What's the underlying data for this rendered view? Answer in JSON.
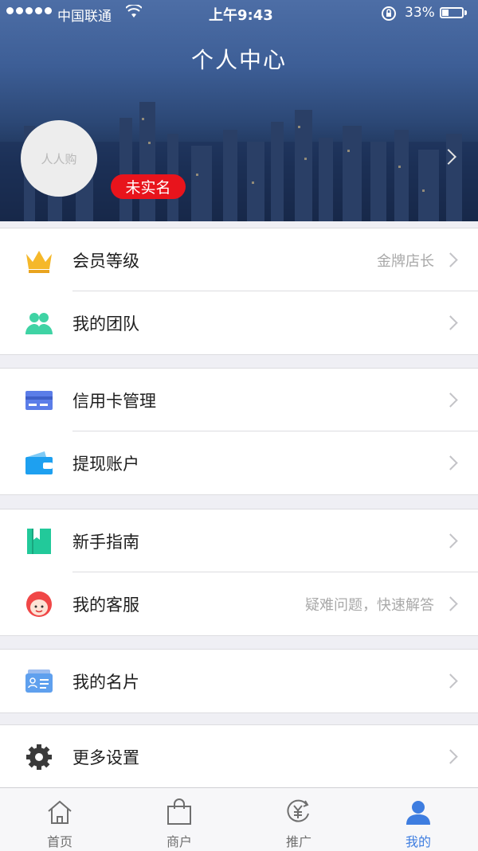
{
  "status_bar": {
    "carrier": "中国联通",
    "time": "上午9:43",
    "battery": "33%"
  },
  "header": {
    "title": "个人中心",
    "avatar_text": "人人购",
    "badge": "未实名"
  },
  "sections": [
    {
      "rows": [
        {
          "label": "会员等级",
          "value": "金牌店长",
          "icon": "crown-icon"
        },
        {
          "label": "我的团队",
          "value": "",
          "icon": "team-icon"
        }
      ]
    },
    {
      "rows": [
        {
          "label": "信用卡管理",
          "value": "",
          "icon": "credit-card-icon"
        },
        {
          "label": "提现账户",
          "value": "",
          "icon": "wallet-icon"
        }
      ]
    },
    {
      "rows": [
        {
          "label": "新手指南",
          "value": "",
          "icon": "guide-book-icon"
        },
        {
          "label": "我的客服",
          "value": "疑难问题，快速解答",
          "icon": "customer-service-icon"
        }
      ]
    },
    {
      "rows": [
        {
          "label": "我的名片",
          "value": "",
          "icon": "business-card-icon"
        }
      ]
    },
    {
      "rows": [
        {
          "label": "更多设置",
          "value": "",
          "icon": "gear-icon"
        }
      ]
    }
  ],
  "tabbar": {
    "tabs": [
      {
        "label": "首页",
        "icon": "home-icon"
      },
      {
        "label": "商户",
        "icon": "shopping-bag-icon"
      },
      {
        "label": "推广",
        "icon": "yuan-promo-icon"
      },
      {
        "label": "我的",
        "icon": "user-icon"
      }
    ],
    "active": "我的"
  },
  "colors": {
    "accent": "#3e7de0",
    "badge": "#e8141c",
    "crown": "#f5b82a",
    "team": "#3fd3a4",
    "card": "#5b7de8",
    "wallet": "#1ea0f0",
    "guide": "#22c99a",
    "service": "#f04747"
  }
}
